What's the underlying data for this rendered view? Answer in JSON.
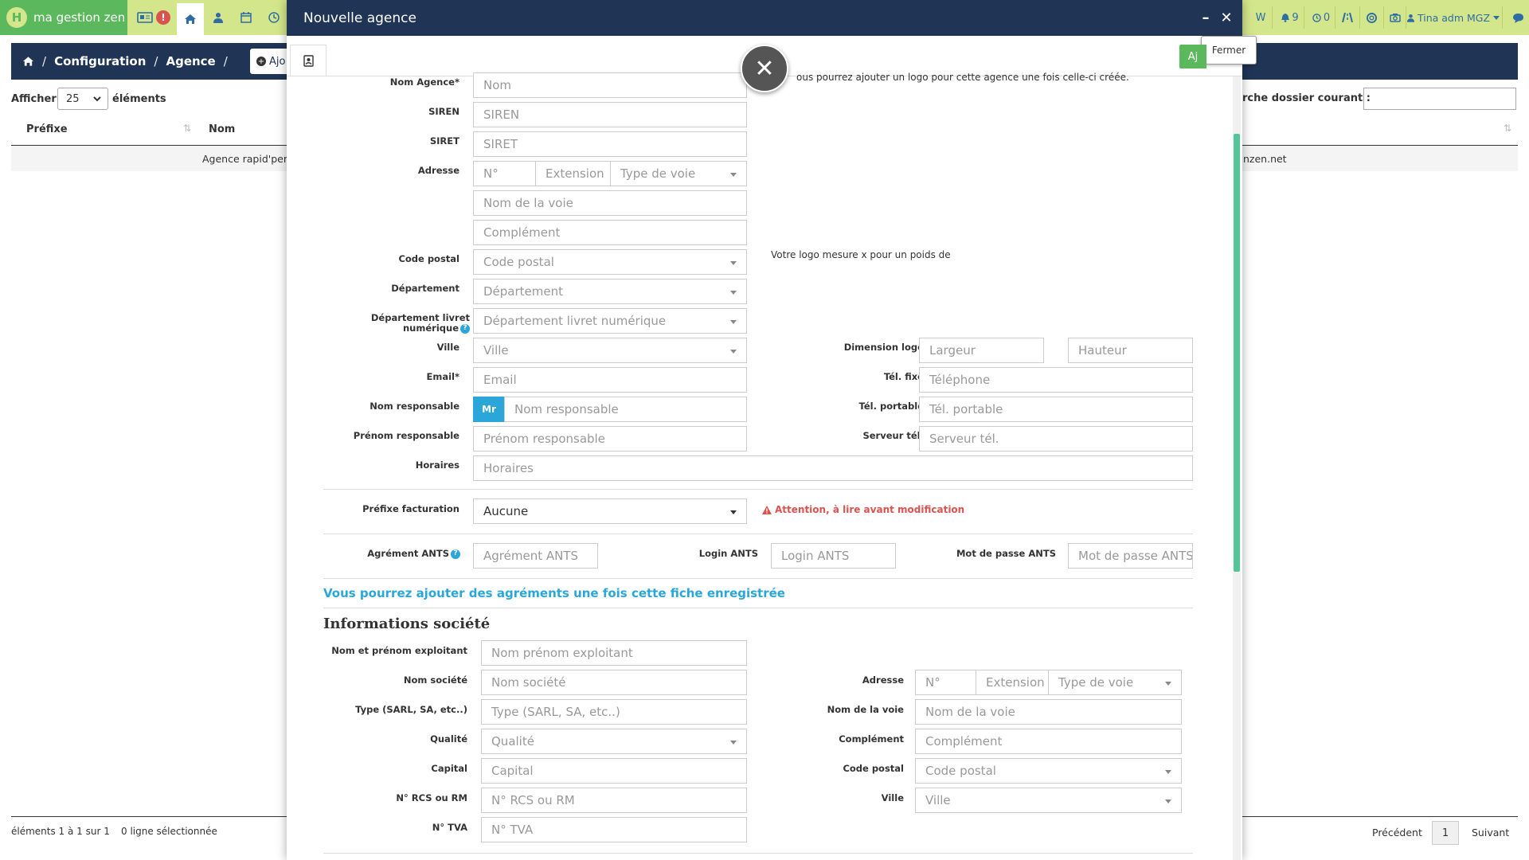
{
  "topbar": {
    "brand": "ma gestion zen",
    "brand_logo": "H",
    "alert_count": "!",
    "w_label": "W",
    "bell_count": "9",
    "clock_count": "0",
    "user": "Tina adm MGZ",
    "colors": {
      "bar": "#d4e68c",
      "brand": "#5cb85c",
      "navy": "#203456"
    }
  },
  "breadcrumb": {
    "home_icon": "home-icon",
    "items": [
      "Configuration",
      "Agence"
    ],
    "add_button": "Ajo"
  },
  "list": {
    "show_label": "Afficher",
    "show_value": "25",
    "elements_label": "éléments",
    "search_label": "rche dossier courant :",
    "columns": [
      "Préfixe",
      "Nom"
    ],
    "row_text": "Agence rapid'perr",
    "row_right": "nzen.net",
    "footer_info": "éléments 1 à 1 sur 1",
    "footer_selected": "0 ligne sélectionnée",
    "prev": "Précédent",
    "page": "1",
    "next": "Suivant"
  },
  "modal": {
    "title": "Nouvelle agence",
    "minimize": "–",
    "close": "✕",
    "tooltip": "Fermer",
    "green_btn": "Aj",
    "overlay_close": "✕",
    "logo_note": "ous pourrez ajouter un logo pour cette agence une fois celle-ci créée.",
    "logo_size_note": "Votre logo mesure x pour un poids de",
    "labels": {
      "nom_agence": "Nom Agence*",
      "siren": "SIREN",
      "siret": "SIRET",
      "adresse": "Adresse",
      "code_postal": "Code postal",
      "departement": "Département",
      "dep_livret": "Département livret numérique",
      "ville": "Ville",
      "email": "Email*",
      "nom_resp": "Nom responsable",
      "prenom_resp": "Prénom responsable",
      "horaires": "Horaires",
      "dimension_logo": "Dimension logo",
      "tel_fixe": "Tél. fixe",
      "tel_portable": "Tél. portable",
      "serveur_tel": "Serveur tél.",
      "prefixe_fact": "Préfixe facturation",
      "agrement_ants": "Agrément ANTS",
      "login_ants": "Login ANTS",
      "mdp_ants": "Mot de passe ANTS"
    },
    "placeholders": {
      "nom": "Nom",
      "siren": "SIREN",
      "siret": "SIRET",
      "num": "N°",
      "extension": "Extension",
      "type_voie": "Type de voie",
      "nom_voie": "Nom de la voie",
      "complement": "Complément",
      "code_postal": "Code postal",
      "departement": "Département",
      "dep_livret": "Département livret numérique",
      "ville": "Ville",
      "email": "Email",
      "nom_resp": "Nom responsable",
      "prenom_resp": "Prénom responsable",
      "horaires": "Horaires",
      "largeur": "Largeur",
      "hauteur": "Hauteur",
      "telephone": "Téléphone",
      "tel_portable": "Tél. portable",
      "serveur_tel": "Serveur tél.",
      "agrement_ants": "Agrément ANTS",
      "login_ants": "Login ANTS",
      "mdp_ants": "Mot de passe ANTS"
    },
    "civility": "Mr",
    "prefixe_value": "Aucune",
    "warning": "Attention, à lire avant modification",
    "agrements_note": "Vous pourrez ajouter des agréments une fois cette fiche enregistrée",
    "company": {
      "title": "Informations société",
      "labels": {
        "exploitant": "Nom et prénom exploitant",
        "nom_societe": "Nom société",
        "type": "Type (SARL, SA, etc..)",
        "qualite": "Qualité",
        "capital": "Capital",
        "rcs": "N° RCS ou RM",
        "tva": "N° TVA",
        "adresse": "Adresse",
        "nom_voie": "Nom de la voie",
        "complement": "Complément",
        "code_postal": "Code postal",
        "ville": "Ville"
      },
      "placeholders": {
        "exploitant": "Nom prénom exploitant",
        "nom_societe": "Nom société",
        "type": "Type (SARL, SA, etc..)",
        "qualite": "Qualité",
        "capital": "Capital",
        "rcs": "N° RCS ou RM",
        "tva": "N° TVA",
        "num": "N°",
        "extension": "Extension",
        "type_voie": "Type de voie",
        "nom_voie": "Nom de la voie",
        "complement": "Complément",
        "code_postal": "Code postal",
        "ville": "Ville"
      }
    }
  }
}
